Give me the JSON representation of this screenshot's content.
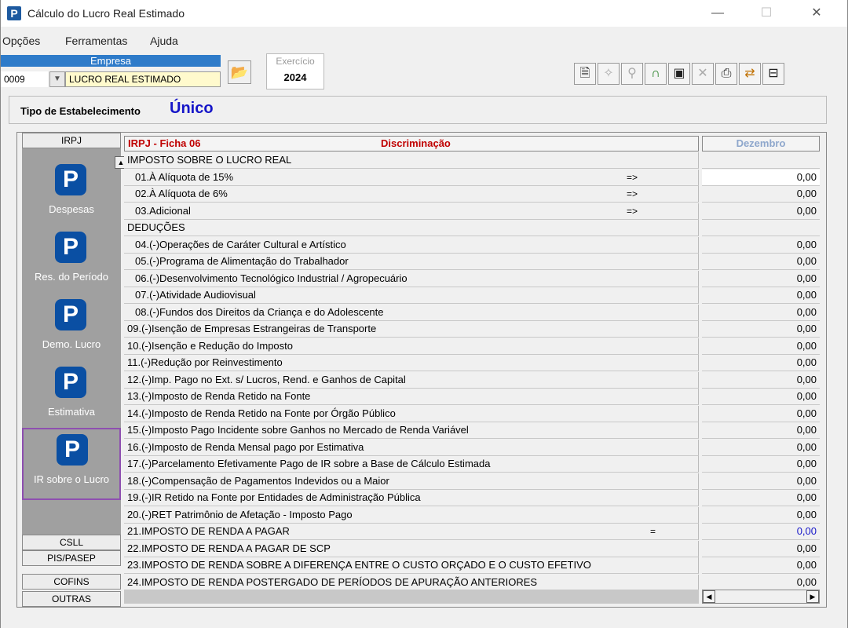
{
  "window": {
    "title": "Cálculo do Lucro Real Estimado"
  },
  "menu": [
    "Opções",
    "Ferramentas",
    "Ajuda"
  ],
  "empresa": {
    "label": "Empresa",
    "code": "0009",
    "name": "LUCRO REAL ESTIMADO"
  },
  "exercicio": {
    "label": "Exercício",
    "value": "2024"
  },
  "tipo": {
    "label": "Tipo de Estabelecimento",
    "value": "Único"
  },
  "tabs": {
    "irpj": "IRPJ",
    "csll": "CSLL",
    "pis": "PIS/PASEP",
    "cofins": "COFINS",
    "outras": "OUTRAS"
  },
  "nav": [
    {
      "label": "Despesas"
    },
    {
      "label": "Res. do Período"
    },
    {
      "label": "Demo. Lucro"
    },
    {
      "label": "Estimativa"
    },
    {
      "label": "IR sobre o Lucro"
    }
  ],
  "grid": {
    "ficha": "IRPJ - Ficha 06",
    "discriminacao": "Discriminação",
    "month": "Dezembro",
    "rows": [
      {
        "desc": "IMPOSTO SOBRE O LUCRO REAL",
        "value": ""
      },
      {
        "desc": "01.À Alíquota de 15%",
        "arrow": "=>",
        "value": "0,00"
      },
      {
        "desc": "02.À Alíquota de 6%",
        "arrow": "=>",
        "value": "0,00"
      },
      {
        "desc": "03.Adicional",
        "arrow": "=>",
        "value": "0,00"
      },
      {
        "desc": "DEDUÇÕES",
        "value": ""
      },
      {
        "desc": "04.(-)Operações de Caráter Cultural e Artístico",
        "value": "0,00"
      },
      {
        "desc": "05.(-)Programa de Alimentação do Trabalhador",
        "value": "0,00"
      },
      {
        "desc": "06.(-)Desenvolvimento Tecnológico Industrial / Agropecuário",
        "value": "0,00"
      },
      {
        "desc": "07.(-)Atividade Audiovisual",
        "value": "0,00"
      },
      {
        "desc": "08.(-)Fundos dos Direitos da Criança e  do Adolescente",
        "value": "0,00"
      },
      {
        "desc": "09.(-)Isenção de Empresas Estrangeiras de Transporte",
        "value": "0,00"
      },
      {
        "desc": "10.(-)Isenção e Redução do Imposto",
        "value": "0,00"
      },
      {
        "desc": "11.(-)Redução por Reinvestimento",
        "value": "0,00"
      },
      {
        "desc": "12.(-)Imp. Pago no Ext. s/ Lucros, Rend. e Ganhos de Capital",
        "value": "0,00"
      },
      {
        "desc": "13.(-)Imposto de Renda Retido na Fonte",
        "value": "0,00"
      },
      {
        "desc": "14.(-)Imposto de Renda Retido na Fonte por Órgão Público",
        "value": "0,00"
      },
      {
        "desc": "15.(-)Imposto Pago Incidente sobre Ganhos no Mercado de Renda Variável",
        "value": "0,00"
      },
      {
        "desc": "16.(-)Imposto de Renda Mensal pago por Estimativa",
        "value": "0,00"
      },
      {
        "desc": "17.(-)Parcelamento Efetivamente Pago de IR sobre a Base de Cálculo Estimada",
        "value": "0,00"
      },
      {
        "desc": "18.(-)Compensação de Pagamentos Indevidos ou a Maior",
        "value": "0,00"
      },
      {
        "desc": "19.(-)IR Retido na Fonte por Entidades de Administração Pública",
        "value": "0,00"
      },
      {
        "desc": "20.(-)RET Patrimônio de Afetação - Imposto Pago",
        "value": "0,00"
      },
      {
        "desc": "21.IMPOSTO DE RENDA A PAGAR",
        "arrow": "=",
        "value": "0,00"
      },
      {
        "desc": "22.IMPOSTO DE RENDA A PAGAR DE SCP",
        "value": "0,00"
      },
      {
        "desc": "23.IMPOSTO DE RENDA SOBRE A DIFERENÇA ENTRE O CUSTO ORÇADO E O CUSTO EFETIVO",
        "value": "0,00"
      },
      {
        "desc": "24.IMPOSTO DE RENDA POSTERGADO DE PERÍODOS DE APURAÇÃO ANTERIORES",
        "value": "0,00"
      }
    ]
  },
  "colors": {
    "accent_blue": "#1515c8",
    "header_red": "#c00000",
    "nav_bg": "#a0a0a0",
    "selection": "#8e4fb0"
  }
}
